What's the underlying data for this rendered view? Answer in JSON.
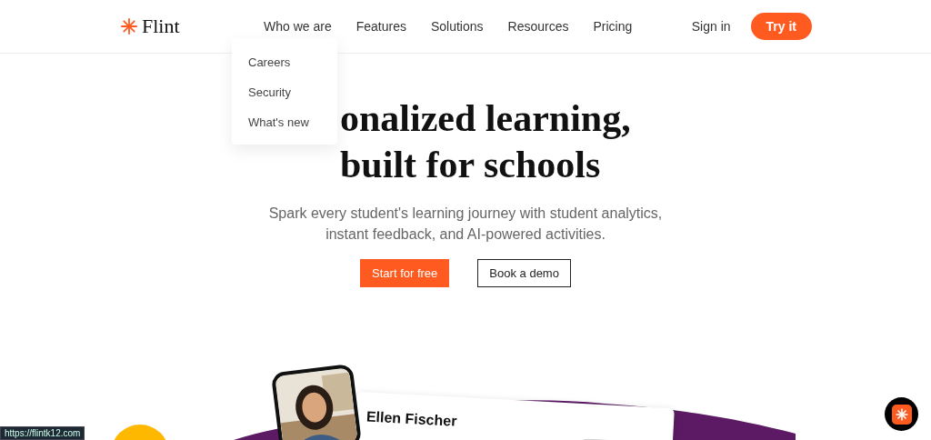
{
  "header": {
    "logo": "Flint",
    "nav": [
      {
        "label": "Who we are",
        "expanded": true,
        "children": [
          "Careers",
          "Security",
          "What's new"
        ]
      },
      {
        "label": "Features"
      },
      {
        "label": "Solutions"
      },
      {
        "label": "Resources"
      },
      {
        "label": "Pricing"
      }
    ],
    "sign_in": "Sign in",
    "cta": "Try it"
  },
  "hero": {
    "title_lines": [
      "onalized learning,",
      "built for schools"
    ],
    "subtitle": "Spark every student's learning journey with student analytics, instant feedback, and AI-powered activities.",
    "primary_button": "Start for free",
    "secondary_button": "Book a demo"
  },
  "showcase": {
    "student_name": "Ellen Fischer"
  },
  "status_url": "https://flintk12.com"
}
